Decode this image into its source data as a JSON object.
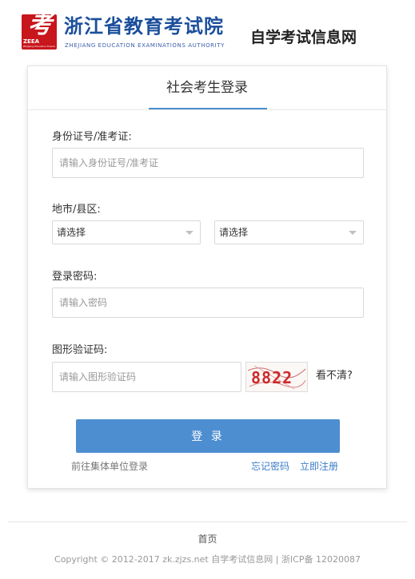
{
  "header": {
    "logo_glyph": "考",
    "logo_abbr": "ZEEA",
    "logo_tiny": "Zhejiang Education Examinations Authority",
    "org_name": "浙江省教育考试院",
    "org_name_en": "ZHEJIANG EDUCATION EXAMINATIONS AUTHORITY",
    "site_name": "自学考试信息网"
  },
  "login": {
    "title": "社会考生登录",
    "id_label": "身份证号/准考证:",
    "id_placeholder": "请输入身份证号/准考证",
    "region_label": "地市/县区:",
    "city_select": "请选择",
    "district_select": "请选择",
    "password_label": "登录密码:",
    "password_placeholder": "请输入密码",
    "captcha_label": "图形验证码:",
    "captcha_placeholder": "请输入图形验证码",
    "captcha_text": "8822",
    "captcha_refresh": "看不清?",
    "submit": "登 录",
    "group_login": "前往集体单位登录",
    "forgot_password": "忘记密码",
    "register": "立即注册"
  },
  "footer": {
    "home": "首页",
    "copyright": "Copyright © 2012-2017 zk.zjzs.net 自学考试信息网   |   浙ICP备 12020087"
  },
  "colors": {
    "brand_blue": "#1b4f9c",
    "logo_red": "#c8161d",
    "accent_blue": "#4d8ed0",
    "link_blue": "#3d7cc9",
    "link_gray": "#777777"
  }
}
